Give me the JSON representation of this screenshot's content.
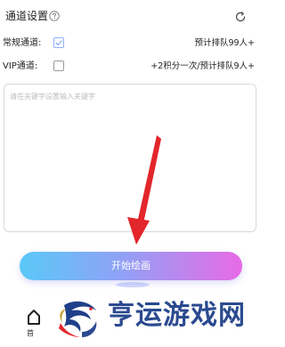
{
  "header": {
    "title": "通道设置"
  },
  "channels": [
    {
      "label": "常规通道:",
      "checked": true,
      "value": "预计排队99人+"
    },
    {
      "label": "VIP通道:",
      "checked": false,
      "value": "+2积分一次/预计排队9人+"
    }
  ],
  "keyword_input": {
    "value": "",
    "placeholder": "请在关键字设置输入关键字"
  },
  "start_button": {
    "label": "开始绘画"
  },
  "bottom_nav": {
    "home_label": "首"
  },
  "watermark": {
    "text": "亨运游戏网"
  },
  "colors": {
    "gradient_start": "#5ac8f8",
    "gradient_end": "#e86ae6",
    "arrow": "#e3262b",
    "watermark": "#2b4a8f"
  },
  "icons": {
    "help": "help-circle-icon",
    "refresh": "refresh-icon",
    "checkmark": "check-icon",
    "home": "home-icon"
  }
}
